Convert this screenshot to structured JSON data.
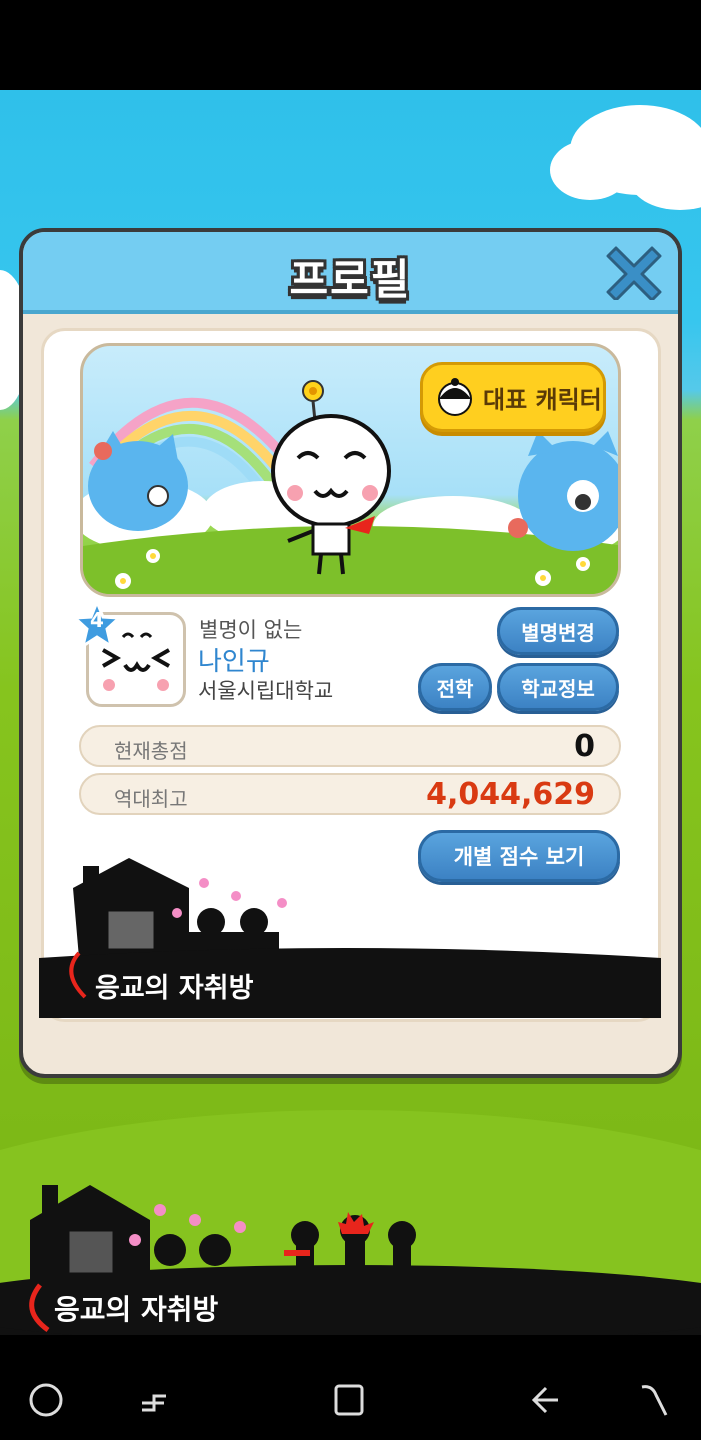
{
  "panel": {
    "title": "프로필",
    "representative_button": "대표 캐릭터"
  },
  "profile": {
    "level": "4",
    "nickname": "별명이 없는",
    "name": "나인규",
    "school": "서울시립대학교"
  },
  "buttons": {
    "change_nickname": "별명변경",
    "transfer": "전학",
    "school_info": "학교정보",
    "view_scores": "개별 점수 보기"
  },
  "scores": {
    "current_label": "현재총점",
    "current_value": "0",
    "best_label": "역대최고",
    "best_value": "4,044,629",
    "best_color": "#d93a12"
  },
  "branding": {
    "logo_text_1": "응교의 자취방",
    "logo_text_2": "응교의 자취방"
  },
  "colors": {
    "header": "#74cdf2",
    "accent_blue": "#3c82c4",
    "rep_yellow": "#ffcf1f"
  }
}
